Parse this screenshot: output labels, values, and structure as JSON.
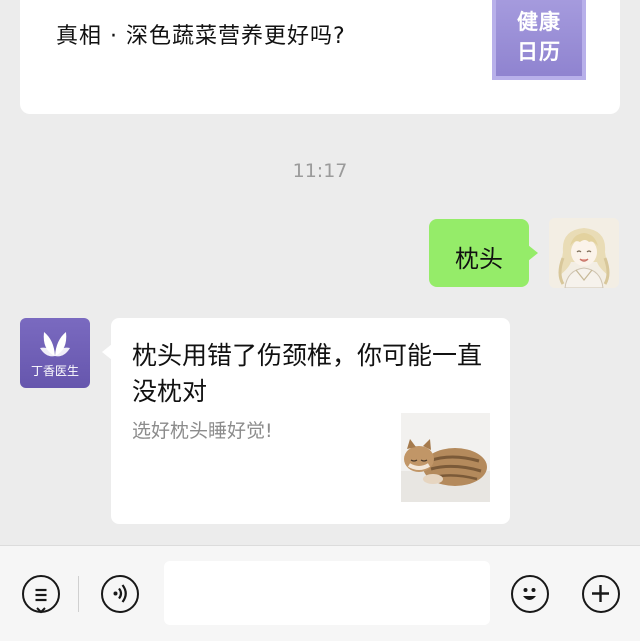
{
  "article": {
    "title": "真相 · 深色蔬菜营养更好吗?",
    "badge_line1": "健康",
    "badge_line2": "日历"
  },
  "timestamp": "11:17",
  "outgoing": {
    "text": "枕头"
  },
  "incoming": {
    "brand": "丁香医生",
    "title": "枕头用错了伤颈椎，你可能一直没枕对",
    "description": "选好枕头睡好觉!"
  },
  "input": {
    "value": "",
    "placeholder": ""
  },
  "icons": {
    "menu": "list-menu-icon",
    "voice": "voice-icon",
    "emoji": "emoji-smile-icon",
    "plus": "plus-icon"
  },
  "colors": {
    "background": "#ececec",
    "bubble_out": "#95ec69",
    "brand_purple": "#6f5fb7",
    "badge_purple": "#9a8fd6",
    "timestamp": "#9b9b9b"
  }
}
